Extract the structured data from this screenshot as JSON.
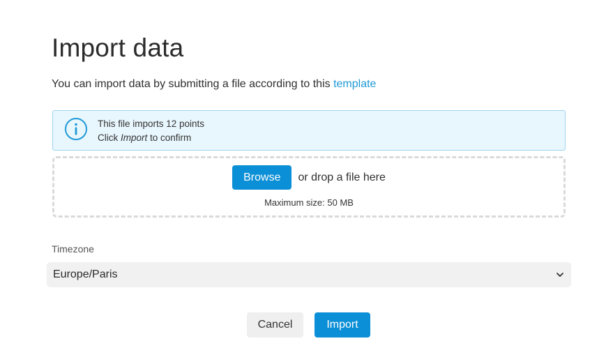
{
  "dialog": {
    "title": "Import data",
    "intro_text": "You can import data by submitting a file according to this ",
    "intro_link": "template"
  },
  "info": {
    "icon": "info-icon",
    "line1": "This file imports 12 points",
    "line2_prefix": "Click ",
    "line2_emphasis": "Import",
    "line2_suffix": " to confirm",
    "colors": {
      "background": "#e8f6fd",
      "border": "#9fd4ee",
      "icon": "#1f9ad6"
    }
  },
  "dropzone": {
    "browse_label": "Browse",
    "drop_text": "or drop a file here",
    "max_size_text": "Maximum size: 50 MB"
  },
  "timezone": {
    "label": "Timezone",
    "value": "Europe/Paris",
    "icon": "chevron-down-icon"
  },
  "actions": {
    "cancel_label": "Cancel",
    "import_label": "Import"
  },
  "colors": {
    "accent": "#0b8fd6",
    "link": "#1f9ad6"
  }
}
